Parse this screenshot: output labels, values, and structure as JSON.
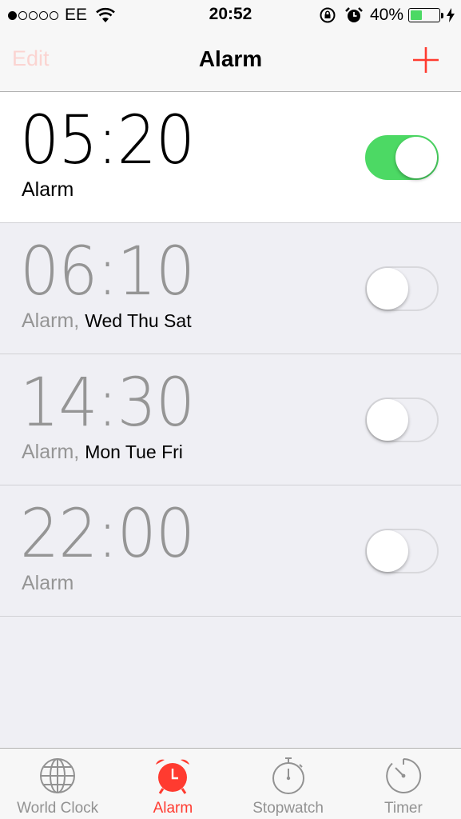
{
  "status_bar": {
    "carrier": "EE",
    "time": "20:52",
    "battery_percent": "40%",
    "battery_level": 0.4,
    "signal_bars_filled": 1,
    "signal_bars_total": 5
  },
  "nav": {
    "edit_label": "Edit",
    "title": "Alarm",
    "add_icon": "plus-icon"
  },
  "alarms": [
    {
      "time": "05:20",
      "label": "Alarm",
      "days": "",
      "enabled": true
    },
    {
      "time": "06:10",
      "label": "Alarm,",
      "days": "Wed Thu Sat",
      "enabled": false
    },
    {
      "time": "14:30",
      "label": "Alarm,",
      "days": "Mon Tue Fri",
      "enabled": false
    },
    {
      "time": "22:00",
      "label": "Alarm",
      "days": "",
      "enabled": false
    }
  ],
  "tabs": [
    {
      "label": "World Clock",
      "icon": "globe-icon",
      "active": false
    },
    {
      "label": "Alarm",
      "icon": "alarm-clock-icon",
      "active": true
    },
    {
      "label": "Stopwatch",
      "icon": "stopwatch-icon",
      "active": false
    },
    {
      "label": "Timer",
      "icon": "timer-icon",
      "active": false
    }
  ],
  "colors": {
    "accent": "#ff3b30",
    "toggle_on": "#4cd964",
    "inactive_text": "#959595",
    "background": "#efeff4"
  }
}
